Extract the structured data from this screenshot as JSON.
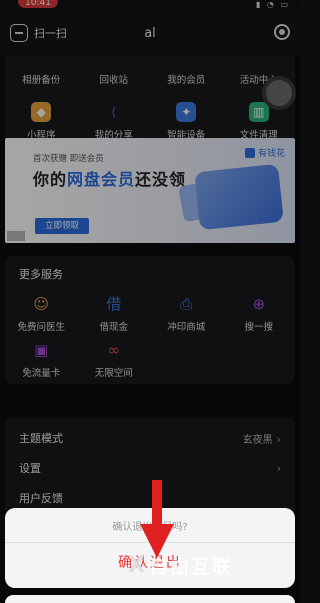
{
  "status": {
    "time": "10:41",
    "icons": "▮ ◔ ▭"
  },
  "header": {
    "scan_label": "扫一扫",
    "title": "al"
  },
  "grid_top": [
    {
      "label": "相册备份",
      "icon": "photo-backup-icon",
      "color": "#e0504a"
    },
    {
      "label": "回收站",
      "icon": "recycle-bin-icon",
      "color": "#3c7be0"
    },
    {
      "label": "我的会员",
      "icon": "member-icon",
      "color": "#e0a420"
    },
    {
      "label": "活动中心",
      "icon": "activity-icon",
      "color": "#d14a8a"
    }
  ],
  "grid_bottom": [
    {
      "label": "小程序",
      "icon": "mini-program-icon",
      "color": "#e6a23c",
      "glyph": "◆"
    },
    {
      "label": "我的分享",
      "icon": "share-icon",
      "color": "#3c7be0",
      "glyph": "⟨"
    },
    {
      "label": "智能设备",
      "icon": "smart-device-icon",
      "color": "#3c7be0",
      "glyph": "✦"
    },
    {
      "label": "文件清理",
      "icon": "file-cleanup-icon",
      "color": "#2fb37a",
      "glyph": "▥"
    }
  ],
  "banner": {
    "small": "首次获赠 即送会员",
    "prefix": "你的",
    "highlight": "网盘会员",
    "suffix": "还没领",
    "cta": "立即领取",
    "brand": "有钱花"
  },
  "services": {
    "title": "更多服务",
    "items": [
      {
        "label": "免费问医生",
        "icon": "doctor-icon",
        "color": "#e6a23c",
        "glyph": "☺"
      },
      {
        "label": "借现金",
        "icon": "borrow-cash-icon",
        "color": "#3c7be0",
        "glyph": "借"
      },
      {
        "label": "冲印商城",
        "icon": "print-shop-icon",
        "color": "#3c7be0",
        "glyph": "⎙"
      },
      {
        "label": "搜一搜",
        "icon": "search-icon",
        "color": "#a24fd6",
        "glyph": "⊕"
      },
      {
        "label": "免流量卡",
        "icon": "data-card-icon",
        "color": "#a24fd6",
        "glyph": "▣"
      },
      {
        "label": "无限空间",
        "icon": "infinite-space-icon",
        "color": "#e0504a",
        "glyph": "∞"
      }
    ]
  },
  "settings": {
    "theme_label": "主题模式",
    "theme_value": "玄夜黑",
    "settings_label": "设置",
    "feedback_label": "用户反馈"
  },
  "sheet": {
    "prompt": "确认退出账号吗?",
    "confirm": "确认退出"
  },
  "watermark": {
    "mark": "X",
    "text": "自由互联"
  },
  "colors": {
    "accent": "#2d6cdf",
    "danger": "#e53b3b",
    "arrow": "#e02020"
  }
}
